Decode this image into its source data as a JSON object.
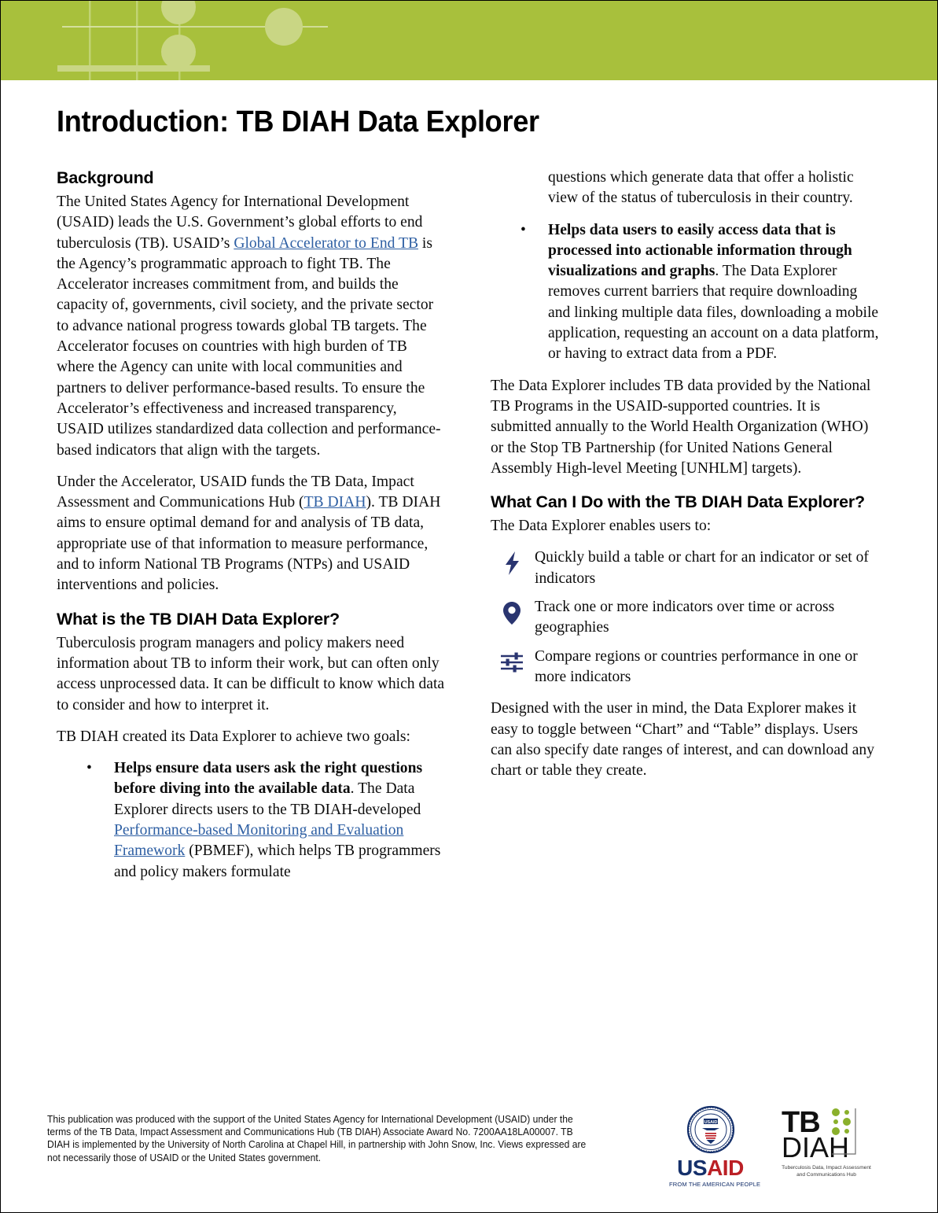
{
  "document": {
    "title": "Introduction: TB DIAH Data Explorer"
  },
  "header": {
    "band_color": "#a8c03c",
    "accent_color": "#c9d684"
  },
  "left_column": {
    "background_heading": "Background",
    "para_1_pre": "The United States Agency for International Development (USAID) leads the U.S. Government’s global efforts to end tuberculosis (TB). USAID’s ",
    "para_1_link": "Global Accelerator to End TB",
    "para_1_post": " is the Agency’s programmatic approach to fight TB. The Accelerator increases commitment from, and builds the capacity of, governments, civil society, and the private sector to advance national progress towards global TB targets. The Accelerator focuses on countries with high burden of TB where the Agency can unite with local communities and partners to deliver performance-based results. To ensure the Accelerator’s effectiveness and increased transparency, USAID utilizes standardized data collection and performance-based indicators that align with the targets.",
    "para_2_pre": "Under the Accelerator, USAID funds the TB Data, Impact Assessment and Communications Hub (",
    "para_2_link": "TB DIAH",
    "para_2_post": "). TB DIAH aims to ensure optimal demand for and analysis of TB data, appropriate use of that information to measure performance, and to inform National TB Programs (NTPs) and USAID interventions and policies.",
    "what_is_heading": "What is the TB DIAH Data Explorer?",
    "para_3": "Tuberculosis program managers and policy makers need information about TB to inform their work, but can often only access unprocessed data. It can be difficult to know which data to consider and how to interpret it.",
    "para_4": "TB DIAH created its Data Explorer to achieve two goals:",
    "bullet_1_marker": "•",
    "bullet_1_lead": "Helps ensure data users ask the right questions before diving into the available data",
    "bullet_1_rest_pre": ". The Data Explorer directs users to the TB DIAH-developed ",
    "bullet_1_link": "Performance-based Monitoring and Evaluation Framework",
    "bullet_1_rest_post": " (PBMEF), which helps TB programmers and policy makers formulate"
  },
  "right_column": {
    "continued_text": "questions which generate data that offer a holistic view of the status of tuberculosis in their country.",
    "bullet_2_marker": "•",
    "bullet_2_lead": "Helps data users to easily access data that is processed into actionable information through visualizations and graphs",
    "bullet_2_rest": ". The Data Explorer removes current barriers that require downloading and linking multiple data files, downloading a mobile application, requesting an account on a data platform, or having to extract data from a PDF.",
    "para_5": "The Data Explorer includes TB data provided by the National TB Programs in the USAID-supported countries. It is submitted annually to the World Health Organization (WHO) or the Stop TB Partnership (for United Nations General Assembly High-level Meeting [UNHLM] targets).",
    "what_can_heading": "What Can I Do with the TB DIAH Data Explorer?",
    "enables_intro": "The Data Explorer enables users to:",
    "icon_items": [
      {
        "icon": "lightning-bolt-icon",
        "text": "Quickly build a table or chart for an indicator or set of indicators"
      },
      {
        "icon": "map-pin-icon",
        "text": "Track one or more indicators over time or across geographies"
      },
      {
        "icon": "sliders-icon",
        "text": "Compare regions or countries performance in one or more indicators"
      }
    ],
    "icon_color": "#2a3570",
    "para_6": "Designed with the user in mind, the Data Explorer makes it easy to toggle between “Chart” and “Table” displays. Users can also specify date ranges of interest, and can download any chart or table they create."
  },
  "footer": {
    "disclaimer": "This publication was produced with the support of the United States Agency for International Development (USAID) under the terms of the TB Data, Impact Assessment and Communications Hub (TB DIAH) Associate Award No. 7200AA18LA00007. TB DIAH is implemented by the University of North Carolina at Chapel Hill, in partnership with John Snow, Inc. Views expressed are not necessarily those of USAID or the United States government.",
    "usaid_logo": {
      "word_us": "US",
      "word_aid": "AID",
      "tagline": "FROM THE AMERICAN PEOPLE",
      "seal_text": "USAID",
      "color_blue": "#15306b",
      "color_red": "#bb2026"
    },
    "tbdiah_logo": {
      "tb": "TB",
      "diah": "DIAH",
      "tagline_line1": "Tuberculosis Data, Impact Assessment",
      "tagline_line2": "and Communications Hub",
      "dot_color": "#8ab02c"
    }
  }
}
